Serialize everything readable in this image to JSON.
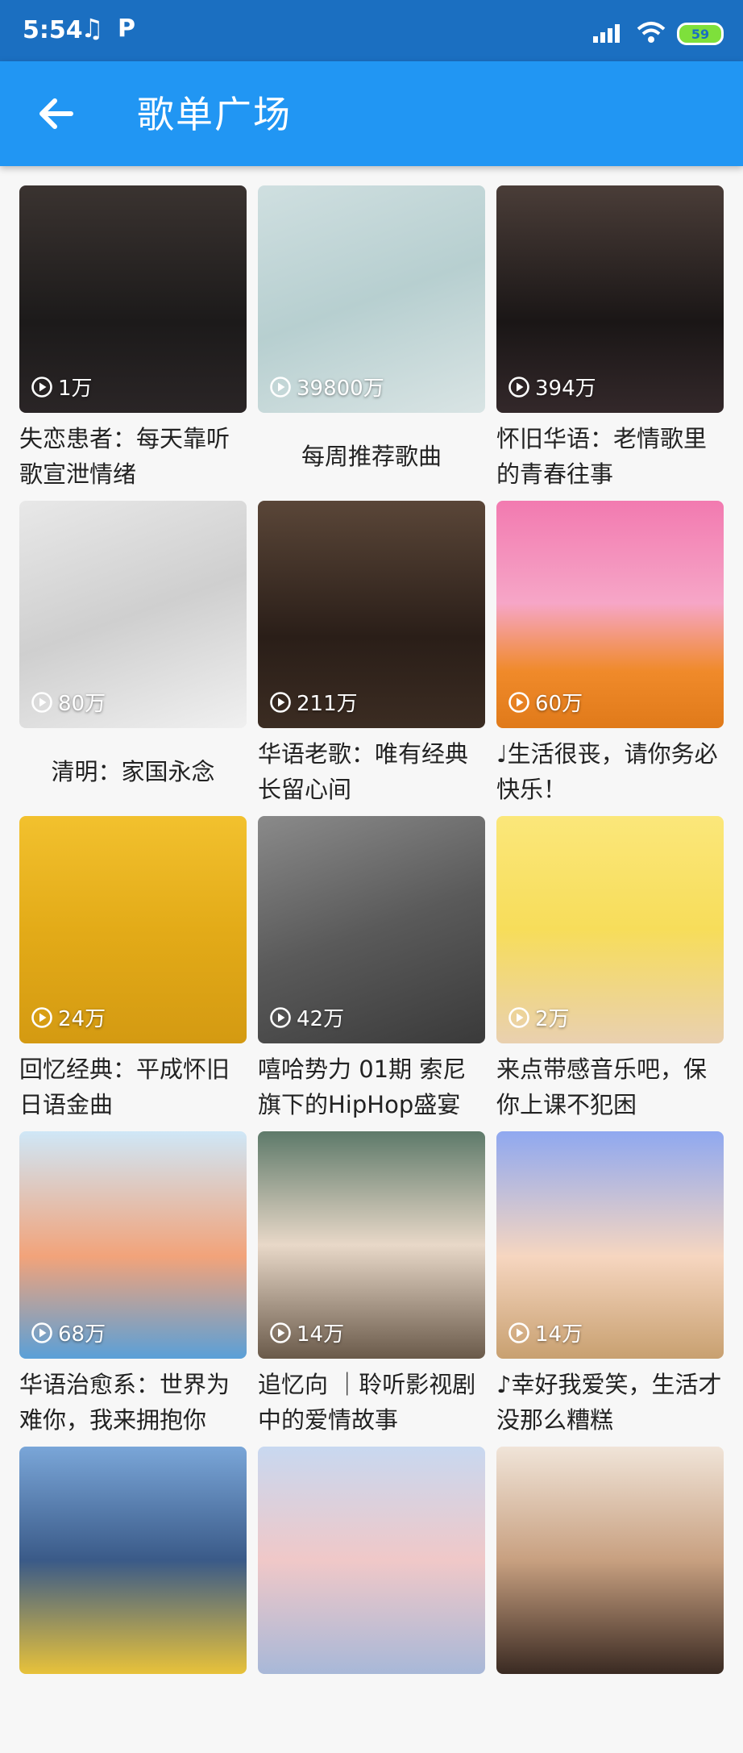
{
  "status_bar": {
    "time": "5:54",
    "battery": "59",
    "icons": [
      "music-note-icon",
      "p-notification-icon",
      "signal-icon",
      "wifi-icon",
      "battery-icon"
    ]
  },
  "app_bar": {
    "title": "歌单广场",
    "back_icon": "arrow-left-icon",
    "color": "#2196f3"
  },
  "playlists": [
    {
      "title": "失恋患者：每天靠听歌宣泄情绪",
      "plays": "1万"
    },
    {
      "title": "每周推荐歌曲",
      "plays": "39800万",
      "centered": true
    },
    {
      "title": "怀旧华语：老情歌里的青春往事",
      "plays": "394万"
    },
    {
      "title": "清明：家国永念",
      "plays": "80万",
      "centered": true
    },
    {
      "title": "华语老歌：唯有经典长留心间",
      "plays": "211万"
    },
    {
      "title": "♩生活很丧，请你务必快乐！",
      "plays": "60万"
    },
    {
      "title": "回忆经典：平成怀旧日语金曲",
      "plays": "24万"
    },
    {
      "title": "嘻哈势力 01期 索尼旗下的HipHop盛宴",
      "plays": "42万"
    },
    {
      "title": "来点带感音乐吧，保你上课不犯困",
      "plays": "2万"
    },
    {
      "title": "华语治愈系：世界为难你，我来拥抱你",
      "plays": "68万"
    },
    {
      "title": "追忆向 ｜聆听影视剧中的爱情故事",
      "plays": "14万"
    },
    {
      "title": "♪幸好我爱笑，生活才没那么糟糕",
      "plays": "14万"
    },
    {
      "title": "",
      "plays": ""
    },
    {
      "title": "",
      "plays": ""
    },
    {
      "title": "",
      "plays": ""
    }
  ]
}
